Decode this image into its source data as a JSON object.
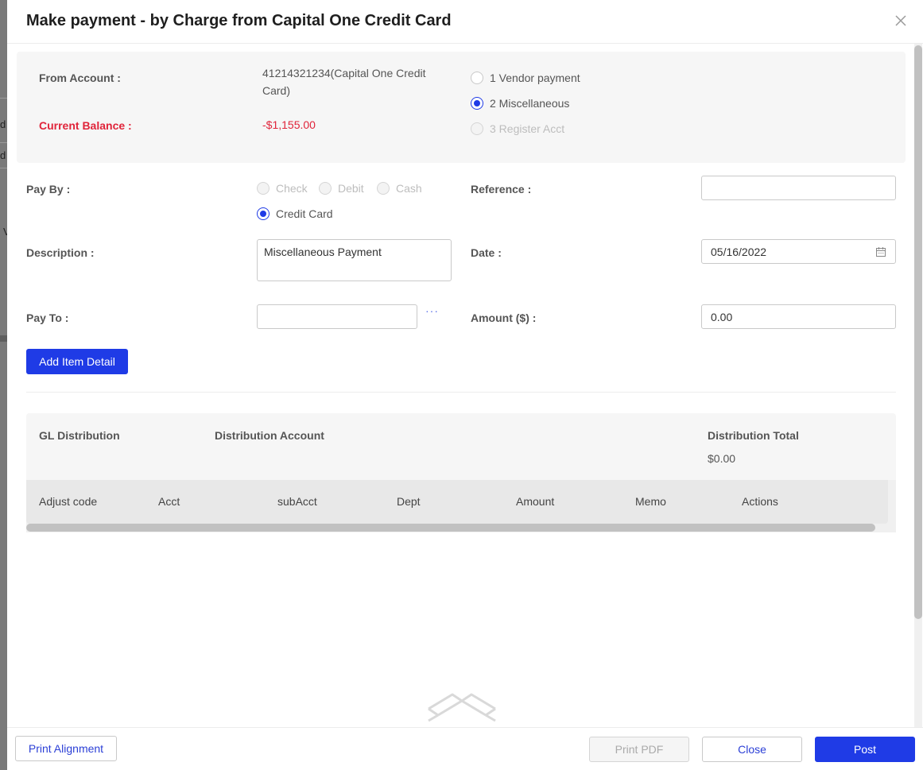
{
  "modal": {
    "title": "Make payment - by Charge from Capital One Credit Card",
    "close_icon": "close-icon"
  },
  "account_info": {
    "from_account_label": "From Account :",
    "from_account_value_line1": "41214321234(Capital One Credit",
    "from_account_value_line2": "Card)",
    "current_balance_label": "Current Balance :",
    "current_balance_value": "-$1,155.00",
    "payment_types": [
      {
        "label": "1 Vendor payment",
        "checked": false,
        "disabled": false
      },
      {
        "label": "2 Miscellaneous",
        "checked": true,
        "disabled": false
      },
      {
        "label": "3 Register Acct",
        "checked": false,
        "disabled": true
      }
    ]
  },
  "form": {
    "pay_by_label": "Pay By :",
    "pay_by_options": [
      {
        "label": "Check",
        "checked": false,
        "disabled": true
      },
      {
        "label": "Debit",
        "checked": false,
        "disabled": true
      },
      {
        "label": "Cash",
        "checked": false,
        "disabled": true
      },
      {
        "label": "Credit Card",
        "checked": true,
        "disabled": false
      }
    ],
    "reference_label": "Reference :",
    "reference_value": "",
    "description_label": "Description :",
    "description_value": "Miscellaneous Payment",
    "date_label": "Date :",
    "date_value": "05/16/2022",
    "date_icon": "calendar-icon",
    "pay_to_label": "Pay To :",
    "pay_to_value": "",
    "pay_to_more": "···",
    "amount_label": "Amount ($) :",
    "amount_value": "0.00",
    "add_item_button": "Add Item Detail"
  },
  "gl_distribution": {
    "title": "GL Distribution",
    "account_header": "Distribution Account",
    "total_header": "Distribution Total",
    "total_value": "$0.00",
    "columns": [
      "Adjust code",
      "Acct",
      "subAcct",
      "Dept",
      "Amount",
      "Memo",
      "Actions"
    ],
    "rows": [],
    "empty_icon": "empty-box-icon"
  },
  "footer": {
    "print_alignment": "Print Alignment",
    "print_pdf": "Print PDF",
    "close": "Close",
    "post": "Post"
  },
  "backdrop": {
    "glyphs": [
      "d",
      "d",
      "V"
    ]
  },
  "colors": {
    "primary": "#1f3be6",
    "danger": "#e0243a",
    "panel_bg": "#f6f6f6"
  }
}
